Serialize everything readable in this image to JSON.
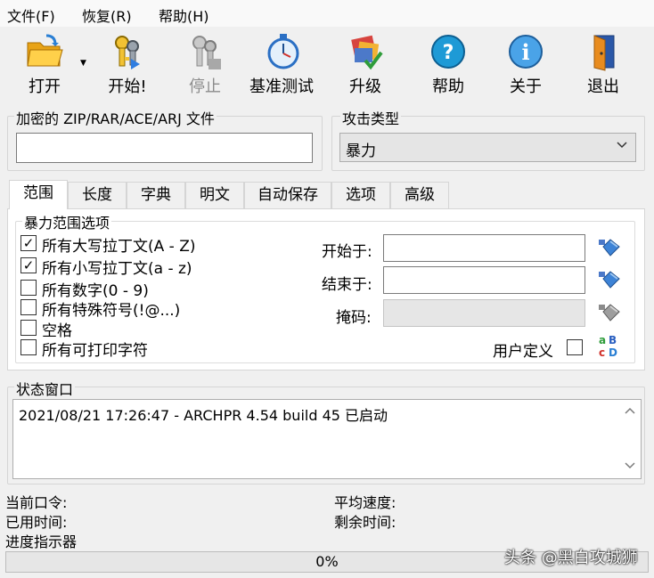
{
  "menu": [
    "文件(F)",
    "恢复(R)",
    "帮助(H)"
  ],
  "toolbar": {
    "open": "打开",
    "start": "开始!",
    "stop": "停止",
    "benchmark": "基准测试",
    "upgrade": "升级",
    "help": "帮助",
    "about": "关于",
    "exit": "退出"
  },
  "file_group": {
    "title": "加密的 ZIP/RAR/ACE/ARJ 文件",
    "value": ""
  },
  "attack_group": {
    "title": "攻击类型",
    "selected": "暴力"
  },
  "tabs": [
    "范围",
    "长度",
    "字典",
    "明文",
    "自动保存",
    "选项",
    "高级"
  ],
  "range": {
    "group_title": "暴力范围选项",
    "options": [
      {
        "label": "所有大写拉丁文(A - Z)",
        "checked": true
      },
      {
        "label": "所有小写拉丁文(a - z)",
        "checked": true
      },
      {
        "label": "所有数字(0 - 9)",
        "checked": false
      },
      {
        "label": "所有特殊符号(!@...)",
        "checked": false
      },
      {
        "label": "空格",
        "checked": false
      },
      {
        "label": "所有可打印字符",
        "checked": false
      }
    ],
    "start_label": "开始于:",
    "end_label": "结束于:",
    "mask_label": "掩码:",
    "start_value": "",
    "end_value": "",
    "mask_value": "",
    "user_defined_label": "用户定义",
    "user_defined_checked": false
  },
  "status": {
    "title": "状态窗口",
    "log": "2021/08/21 17:26:47 - ARCHPR 4.54 build 45 已启动"
  },
  "info": {
    "current_password": "当前口令:",
    "elapsed": "已用时间:",
    "progress_label": "进度指示器",
    "avg_speed": "平均速度:",
    "remaining": "剩余时间:"
  },
  "progress": {
    "text": "0%",
    "value": 0
  },
  "watermark": "头条 @黑白攻城狮",
  "colors": {
    "window_bg": "#f0f0f0",
    "accent": "#2a7fd4"
  }
}
